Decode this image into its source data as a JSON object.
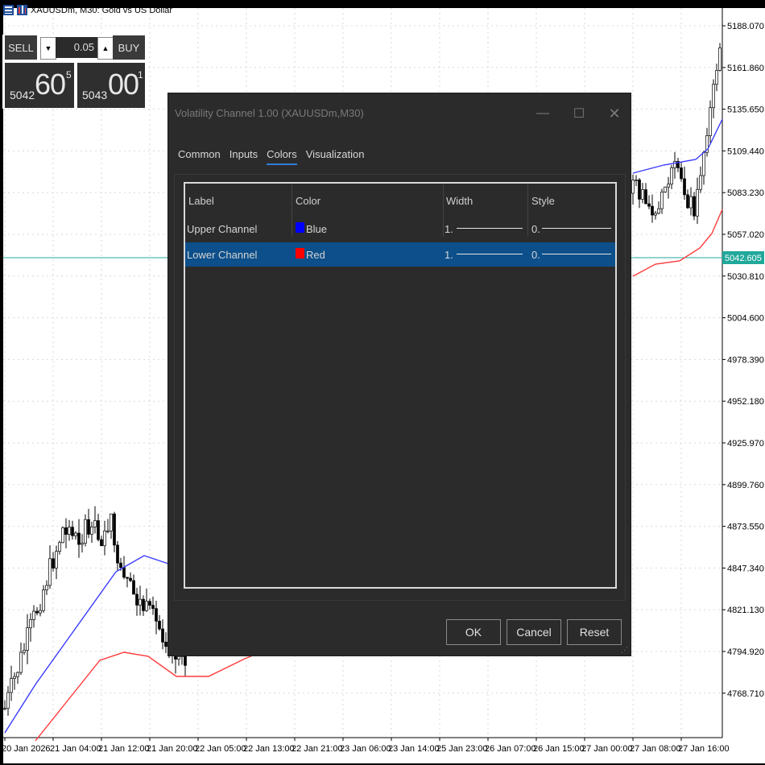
{
  "symbol": {
    "title": "XAUUSDm, M30:  Gold vs US Dollar"
  },
  "trade_panel": {
    "sell_label": "SELL",
    "buy_label": "BUY",
    "lot_value": "0.05",
    "dec_glyph": "▼",
    "inc_glyph": "▲",
    "sell_price": {
      "small": "5042",
      "big": "60",
      "sup": "5"
    },
    "buy_price": {
      "small": "5043",
      "big": "00",
      "sup": "1"
    }
  },
  "price_axis": {
    "labels": [
      "5188.070",
      "5161.860",
      "5135.650",
      "5109.440",
      "5083.230",
      "5057.020",
      "5030.810",
      "5004.600",
      "4978.390",
      "4952.180",
      "4925.970",
      "4899.760",
      "4873.550",
      "4847.340",
      "4821.130",
      "4794.920",
      "4768.710"
    ],
    "current_price": "5042.605",
    "current_color": "#20a89a"
  },
  "time_axis": {
    "labels": [
      "20 Jan 2026",
      "21 Jan 04:00",
      "21 Jan 12:00",
      "21 Jan 20:00",
      "22 Jan 05:00",
      "22 Jan 13:00",
      "22 Jan 21:00",
      "23 Jan 06:00",
      "23 Jan 14:00",
      "25 Jan 23:00",
      "26 Jan 07:00",
      "26 Jan 15:00",
      "27 Jan 00:00",
      "27 Jan 08:00",
      "27 Jan 16:00"
    ]
  },
  "dialog": {
    "title": "Volatility Channel 1.00 (XAUUSDm,M30)",
    "controls": {
      "minimize": "—",
      "maximize": "☐",
      "close": "✕"
    },
    "tabs": [
      {
        "label": "Common",
        "active": false
      },
      {
        "label": "Inputs",
        "active": false
      },
      {
        "label": "Colors",
        "active": true
      },
      {
        "label": "Visualization",
        "active": false
      }
    ],
    "table": {
      "headers": {
        "label": "Label",
        "color": "Color",
        "width": "Width",
        "style": "Style"
      },
      "rows": [
        {
          "label": "Upper Channel",
          "color_name": "Blue",
          "swatch": "#0000ff",
          "width": "1.",
          "style": "0.",
          "selected": false
        },
        {
          "label": "Lower Channel",
          "color_name": "Red",
          "swatch": "#ff0000",
          "width": "1.",
          "style": "0.",
          "selected": true
        }
      ]
    },
    "buttons": {
      "ok": "OK",
      "cancel": "Cancel",
      "reset": "Reset"
    },
    "accent": "#2f7fd8",
    "selected_row_color": "#0c4f8a"
  }
}
